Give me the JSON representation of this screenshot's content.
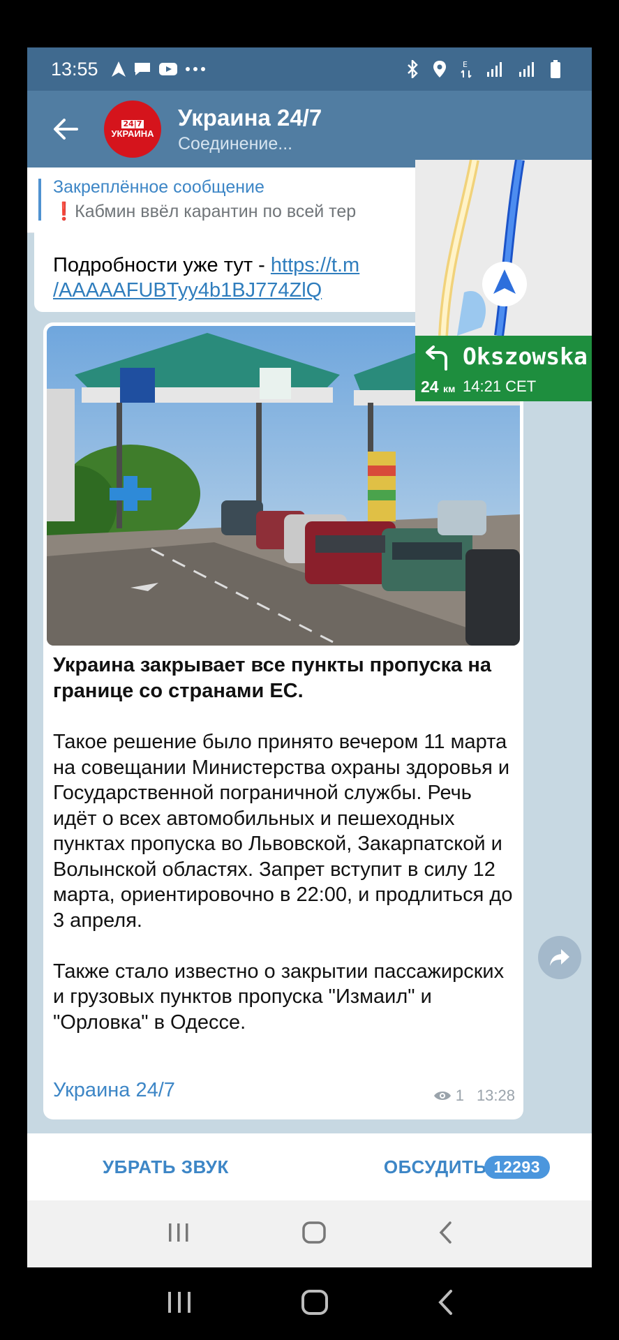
{
  "status_bar": {
    "time": "13:55"
  },
  "channel": {
    "name": "Украина 24/7",
    "status": "Соединение...",
    "avatar_top": "24|7",
    "avatar_bottom": "УКРАИНА"
  },
  "pinned": {
    "title": "Закреплённое сообщение",
    "exclaim": "❗",
    "text": "Кабмин ввёл карантин по всей тер"
  },
  "prev_message": {
    "text_before_link": "Подробности уже тут - ",
    "link_line1": "https://t.m",
    "link_line2": "/AAAAAFUBTyy4b1BJ774ZlQ"
  },
  "post": {
    "headline": "Украина закрывает все пункты пропуска на границе со странами ЕС.",
    "paragraph1": "Такое решение было принято вечером 11 марта на совещании Министерства охраны здоровья и Государственной пограничной службы. Речь идёт о всех автомобильных и пешеходных пунктах пропуска во Львовской, Закарпатской и Волынской областях. Запрет вступит в силу 12 марта, ориентировочно в 22:00, и продлиться до 3 апреля.",
    "paragraph2": "Также стало известно о закрытии пассажирских и грузовых пунктов пропуска \"Измаил\" и \"Орловка\" в Одессе.",
    "signature": "Украина 24/7",
    "views": "1",
    "time": "13:28"
  },
  "actions": {
    "mute": "УБРАТЬ ЗВУК",
    "discuss": "ОБСУДИТЬ",
    "discuss_count": "12293"
  },
  "navigation_widget": {
    "street": "Okszowska",
    "distance": "24",
    "distance_unit": "км",
    "eta": "14:21 CET"
  },
  "colors": {
    "header": "#517da2",
    "status_bar": "#406a8f",
    "accent": "#3d86c6",
    "nav_green": "#1e8e3e",
    "badge": "#4b96dd"
  },
  "icons": [
    "back-arrow-icon",
    "navigation-icon",
    "message-icon",
    "youtube-icon",
    "more-icon",
    "bluetooth-icon",
    "location-icon",
    "signal-icon",
    "battery-icon",
    "eye-icon",
    "share-icon",
    "turn-left-icon",
    "recent-apps-icon",
    "home-icon",
    "nav-back-icon"
  ]
}
